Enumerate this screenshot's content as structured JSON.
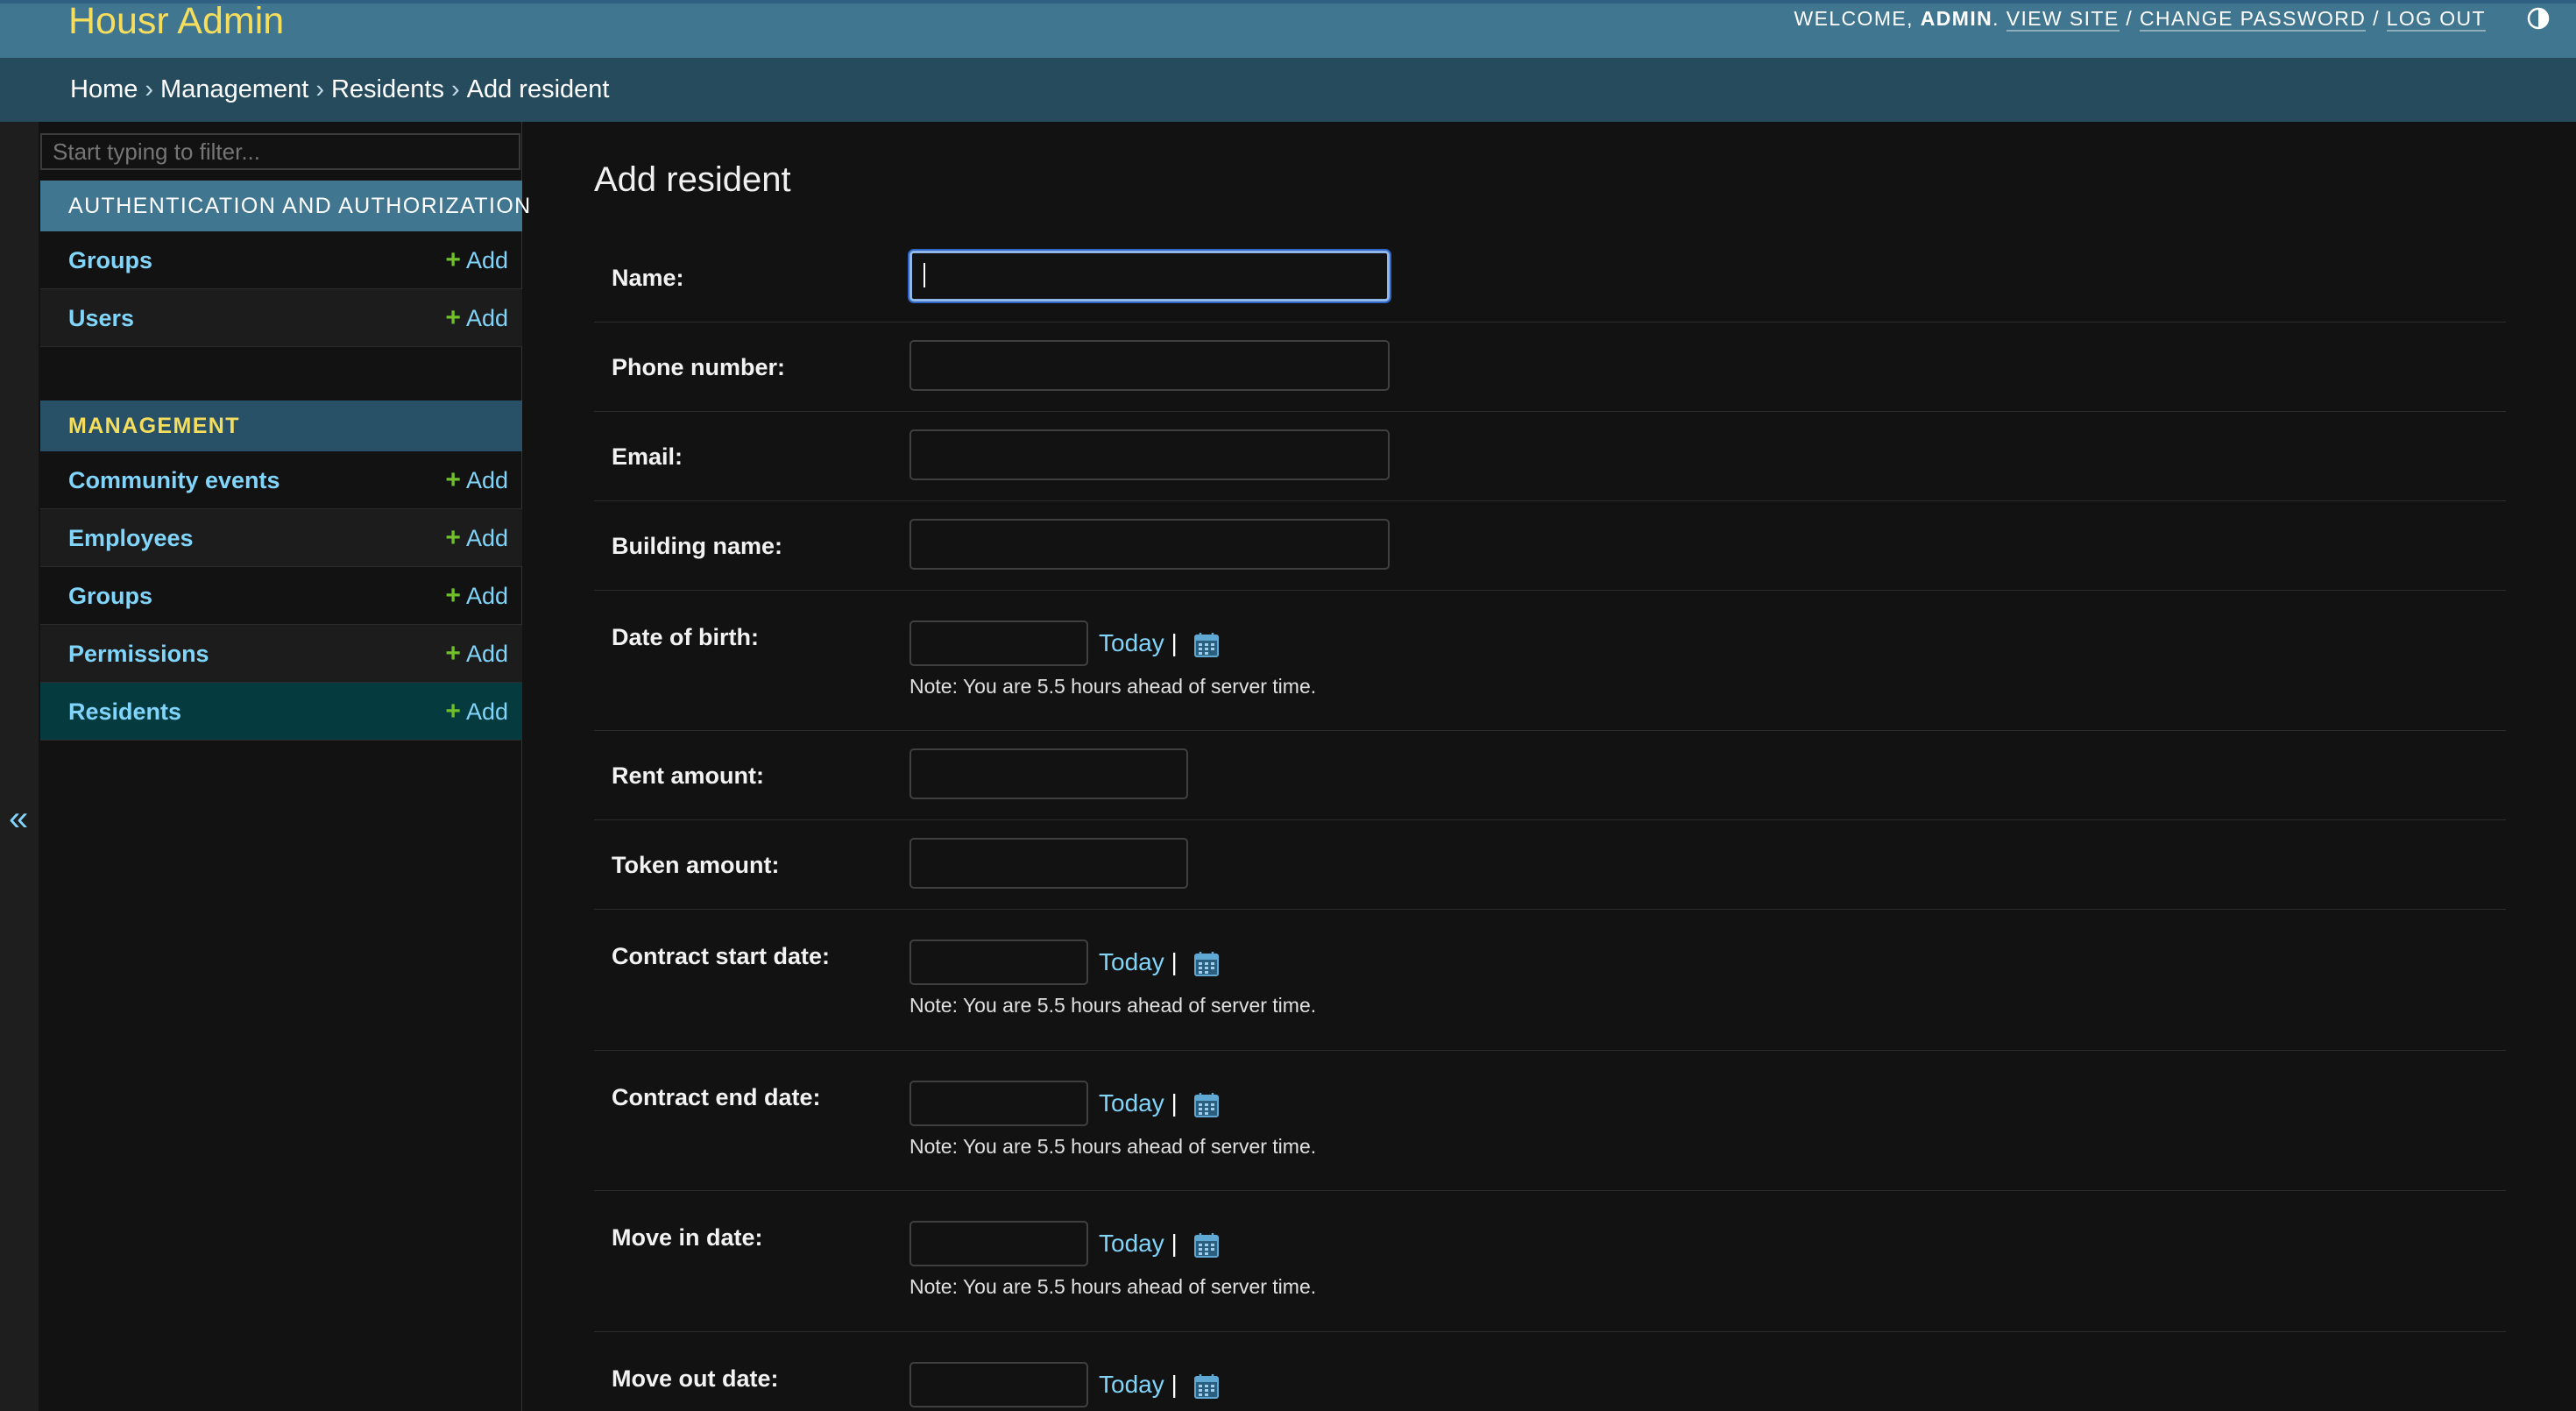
{
  "header": {
    "brand": "Housr Admin",
    "welcome_label": "WELCOME,",
    "username": "ADMIN",
    "period": ".",
    "view_site": "VIEW SITE",
    "change_password": "CHANGE PASSWORD",
    "log_out": "LOG OUT",
    "sep": "/"
  },
  "breadcrumbs": {
    "home": "Home",
    "app": "Management",
    "model": "Residents",
    "current": "Add resident",
    "sep": "›"
  },
  "sidebar": {
    "toggle": "«",
    "filter_placeholder": "Start typing to filter...",
    "modules": [
      {
        "caption": "Authentication and Authorization",
        "items": [
          {
            "label": "Groups",
            "add": "Add"
          },
          {
            "label": "Users",
            "add": "Add"
          }
        ]
      },
      {
        "caption": "Management",
        "items": [
          {
            "label": "Community events",
            "add": "Add"
          },
          {
            "label": "Employees",
            "add": "Add"
          },
          {
            "label": "Groups",
            "add": "Add"
          },
          {
            "label": "Permissions",
            "add": "Add"
          },
          {
            "label": "Residents",
            "add": "Add"
          }
        ]
      }
    ],
    "add_plus": "+"
  },
  "content": {
    "title": "Add resident",
    "fields": {
      "name": {
        "label": "Name:",
        "value": ""
      },
      "phone": {
        "label": "Phone number:",
        "value": ""
      },
      "email": {
        "label": "Email:",
        "value": ""
      },
      "building": {
        "label": "Building name:",
        "value": ""
      },
      "dob": {
        "label": "Date of birth:",
        "value": ""
      },
      "rent": {
        "label": "Rent amount:",
        "value": ""
      },
      "token": {
        "label": "Token amount:",
        "value": ""
      },
      "contract_start": {
        "label": "Contract start date:",
        "value": ""
      },
      "contract_end": {
        "label": "Contract end date:",
        "value": ""
      },
      "move_in": {
        "label": "Move in date:",
        "value": ""
      },
      "move_out": {
        "label": "Move out date:",
        "value": ""
      }
    },
    "today": "Today",
    "pipe": "|",
    "timezone_note": "Note: You are 5.5 hours ahead of server time."
  },
  "colors": {
    "header_bg": "#417690",
    "brand": "#f5dd5d",
    "link": "#81d4fa",
    "add_plus": "#70bf2b",
    "selected_row": "#053a3e"
  },
  "icons": [
    "theme-toggle-icon",
    "calendar-icon",
    "plus-icon"
  ]
}
